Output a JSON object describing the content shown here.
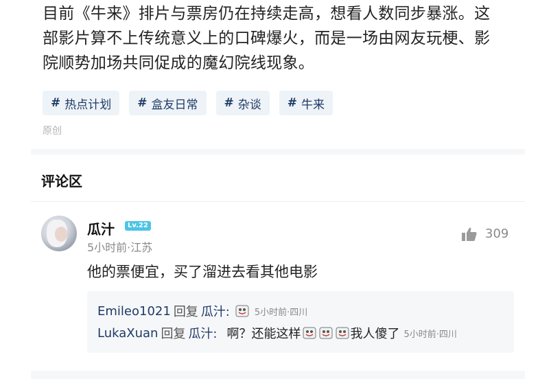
{
  "article": {
    "line1": "目前《牛来》排片与票房仍在持续走高，想看人数同步暴涨。这",
    "line2": "部影片算不上传统意义上的口碑爆火，而是一场由网友玩梗、影",
    "line3": "院顺势加场共同促成的魔幻院线现象。"
  },
  "tags": [
    {
      "symbol": "#",
      "label": "热点计划"
    },
    {
      "symbol": "#",
      "label": "盒友日常"
    },
    {
      "symbol": "#",
      "label": "杂谈"
    },
    {
      "symbol": "#",
      "label": "牛来"
    }
  ],
  "original_label": "原创",
  "comments_section": {
    "title": "评论区"
  },
  "comment": {
    "username": "瓜汁",
    "level": "Lv.22",
    "meta": "5小时前·江苏",
    "likes": "309",
    "text": "他的票便宜，买了溜进去看其他电影",
    "avatar_icon": "avatar-photo",
    "like_icon": "thumbs-up-icon"
  },
  "replies": [
    {
      "name": "Emileo1021",
      "reply_word": "回复",
      "target": "瓜汁:",
      "text": "",
      "emojis": 1,
      "time": "5小时前·四川"
    },
    {
      "name": "LukaXuan",
      "reply_word": "回复",
      "target": "瓜汁:",
      "text": "啊？还能这样",
      "emojis": 3,
      "suffix": "我人傻了",
      "time": "5小时前·四川"
    }
  ],
  "colors": {
    "link": "#1f3a66",
    "tag_bg": "#eef3f8",
    "muted": "#8a8a8a",
    "level_badge": "#4cc4e6"
  }
}
